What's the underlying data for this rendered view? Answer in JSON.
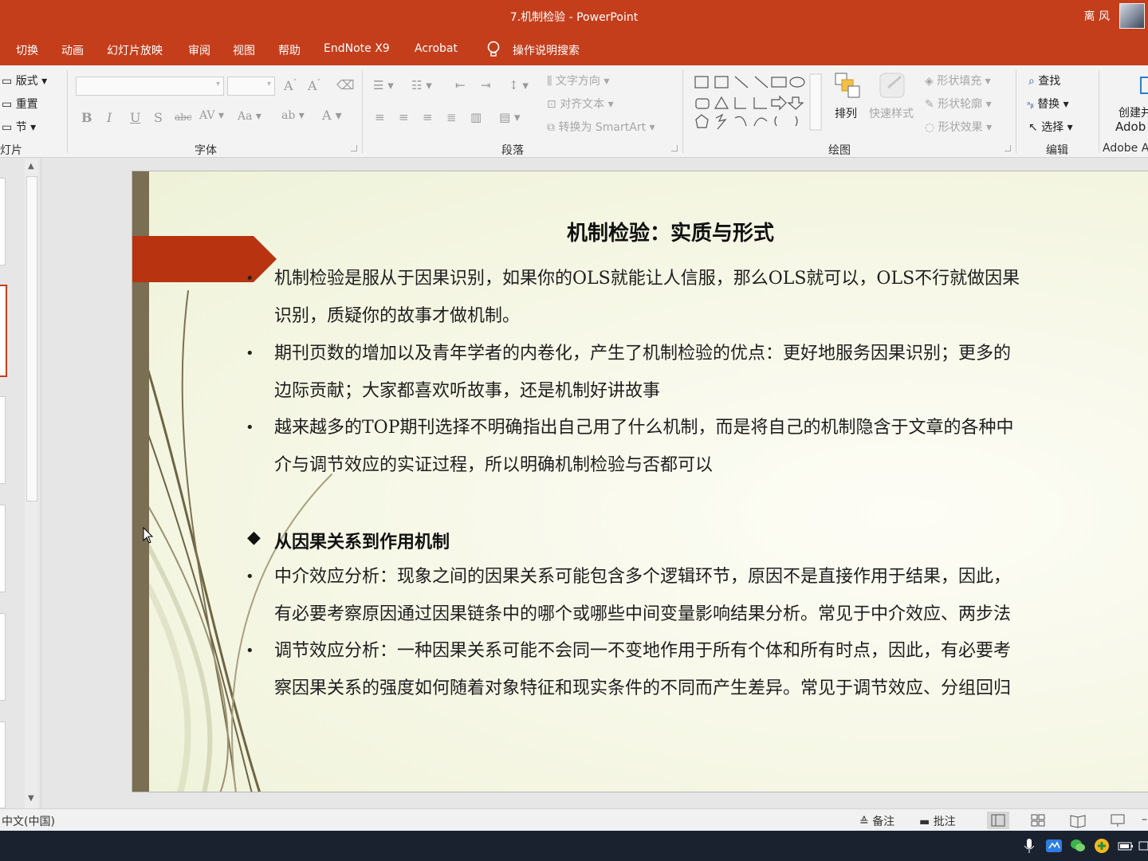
{
  "window": {
    "title": "7.机制检验  -  PowerPoint",
    "user": "离 风"
  },
  "menu_tabs": [
    "切换",
    "动画",
    "幻灯片放映",
    "审阅",
    "视图",
    "帮助",
    "EndNote X9",
    "Acrobat",
    "操作说明搜索"
  ],
  "ribbon": {
    "slides_group": {
      "label": "灯片",
      "layout": "版式",
      "reset": "重置",
      "section": "节"
    },
    "font_group": {
      "label": "字体"
    },
    "paragraph_group": {
      "label": "段落",
      "text_direction": "文字方向",
      "align_text": "对齐文本",
      "convert_smartart": "转换为 SmartArt"
    },
    "drawing_group": {
      "label": "绘图",
      "arrange": "排列",
      "quick_styles": "快速样式",
      "shape_fill": "形状填充",
      "shape_outline": "形状轮廓",
      "shape_effects": "形状效果"
    },
    "editing_group": {
      "label": "编辑",
      "find": "查找",
      "replace": "替换",
      "select": "选择"
    },
    "adobe_group": {
      "create": "创建并",
      "adobe": "Adob",
      "label": "Adobe A"
    }
  },
  "slide": {
    "title": "机制检验：实质与形式",
    "bullets_top": [
      {
        "lines": [
          "机制检验是服从于因果识别，如果你的OLS就能让人信服，那么OLS就可以，OLS不行就做因果",
          "识别，质疑你的故事才做机制。"
        ]
      },
      {
        "lines": [
          "期刊页数的增加以及青年学者的内卷化，产生了机制检验的优点：更好地服务因果识别；更多的",
          "边际贡献；大家都喜欢听故事，还是机制好讲故事"
        ]
      },
      {
        "lines": [
          "越来越多的TOP期刊选择不明确指出自己用了什么机制，而是将自己的机制隐含于文章的各种中",
          "介与调节效应的实证过程，所以明确机制检验与否都可以"
        ]
      }
    ],
    "section_heading": "从因果关系到作用机制",
    "bullets_bottom": [
      {
        "lines": [
          "中介效应分析：现象之间的因果关系可能包含多个逻辑环节，原因不是直接作用于结果，因此，",
          "有必要考察原因通过因果链条中的哪个或哪些中间变量影响结果分析。常见于中介效应、两步法"
        ]
      },
      {
        "lines": [
          "调节效应分析：一种因果关系可能不会同一不变地作用于所有个体和所有时点，因此，有必要考",
          "察因果关系的强度如何随着对象特征和现实条件的不同而产生差异。常见于调节效应、分组回归"
        ]
      }
    ]
  },
  "statusbar": {
    "language": "中文(中国)",
    "notes": "备注",
    "comments": "批注"
  },
  "colors": {
    "accent": "#c43e1c",
    "ribbon_bg": "#f3f3f3",
    "slide_stripe": "#7a6e53",
    "banner": "#b8330f"
  },
  "icons": [
    "lightbulb-icon",
    "find-icon",
    "replace-icon",
    "select-icon",
    "arrange-icon",
    "quick-styles-icon",
    "notes-icon",
    "comments-icon",
    "normal-view-icon",
    "slide-sorter-icon",
    "reading-view-icon",
    "slideshow-icon"
  ]
}
